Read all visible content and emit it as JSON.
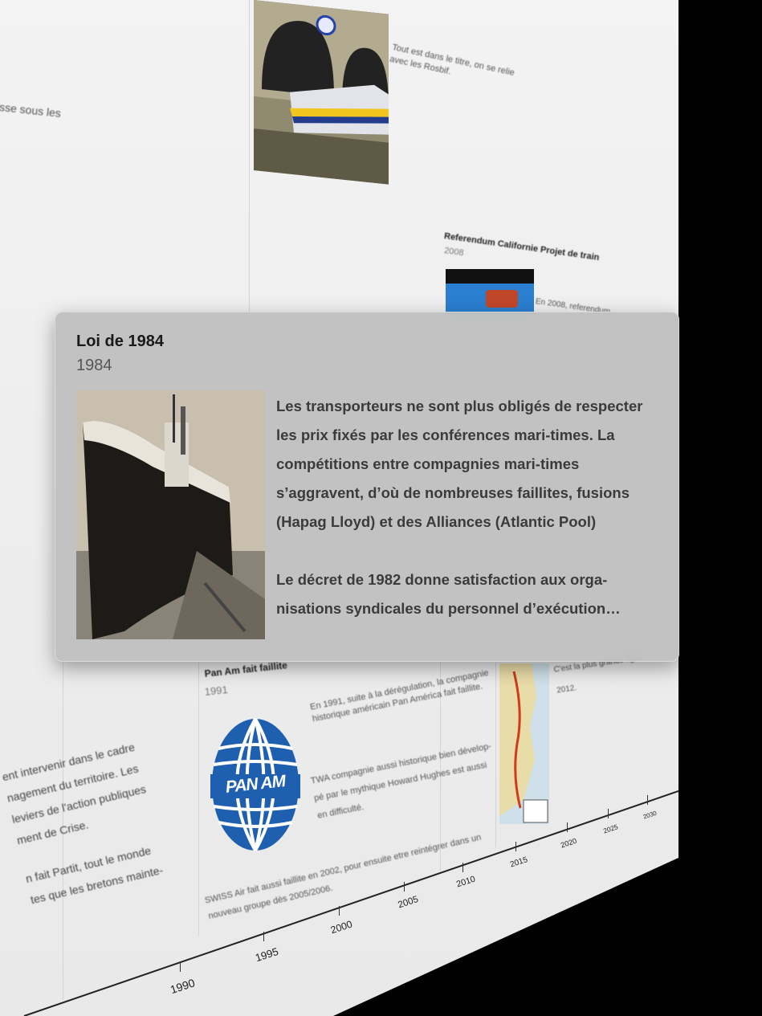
{
  "popup": {
    "title": "Loi de 1984",
    "year": "1984",
    "paragraph1": "Les transporteurs ne sont plus obligés de respecter les prix fixés par les conférences mari-times. La compétitions entre compagnies mari-times s’aggravent, d’où de nombreuses faillites, fusions (Hapag Lloyd) et des Alliances (Atlantic Pool)",
    "paragraph2": "Le décret de 1982 donne satisfaction aux orga-nisations syndicales du personnel d’exécution…",
    "image_icon": "ship-photo"
  },
  "background": {
    "left_fragment_top": "sse sous les",
    "eurostar_text_1": "Tout est dans le titre, on se relie",
    "eurostar_text_2": "avec les Rosbif.",
    "eurostar_image_icon": "eurostar-train-photo",
    "referendum": {
      "title": "Referendum Californie Projet de train",
      "year": "2008",
      "text": "En 2008, referendum"
    },
    "panam": {
      "title": "Pan Am fait faillite",
      "year": "1991",
      "logo_text": "PAN AM",
      "p1_line1": "En 1991, suite à la dérégulation, la compagnie",
      "p1_line2": "historique américain Pan América fait faillite.",
      "p2_line1": "TWA compagnie aussi historique bien dévelop-",
      "p2_line2": "pé par le mythique Howard Hughes est aussi",
      "p2_line3": "en difficulté.",
      "p3_line1": "SWISS Air fait aussi faillite en 2002, pour ensuite etre reintégrer dans un",
      "p3_line2": "nouveau groupe dès 2005/2006."
    },
    "china_map": {
      "text_1": "C'est la plus grande ligne",
      "text_2": "2012.",
      "image_icon": "china-rail-map"
    },
    "left_fragment_bottom": {
      "l1": "ent intervenir dans le cadre",
      "l2": "nagement du territoire. Les",
      "l3": "leviers de l'action publiques",
      "l4": "ment de Crise.",
      "l5": "n fait Partit, tout le monde",
      "l6": "tes que les bretons mainte-"
    },
    "axis_ticks": [
      "1990",
      "1995",
      "2000",
      "2005",
      "2010",
      "2015",
      "2020",
      "2025",
      "2030"
    ]
  },
  "colors": {
    "panam_blue": "#1f5fb0",
    "card_bg": "#bebebe"
  }
}
